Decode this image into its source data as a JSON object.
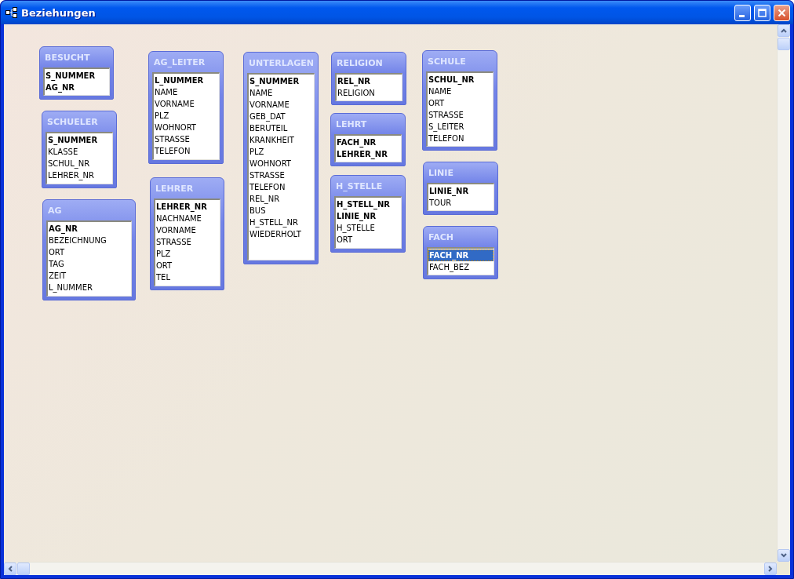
{
  "window": {
    "title": "Beziehungen"
  },
  "tables": [
    {
      "name": "BESUCHT",
      "fields": [
        {
          "name": "S_NUMMER",
          "key": true,
          "selected": false
        },
        {
          "name": "AG_NR",
          "key": true,
          "selected": false
        }
      ]
    },
    {
      "name": "SCHUELER",
      "fields": [
        {
          "name": "S_NUMMER",
          "key": true,
          "selected": false
        },
        {
          "name": "KLASSE",
          "key": false,
          "selected": false
        },
        {
          "name": "SCHUL_NR",
          "key": false,
          "selected": false
        },
        {
          "name": "LEHRER_NR",
          "key": false,
          "selected": false
        }
      ]
    },
    {
      "name": "AG",
      "fields": [
        {
          "name": "AG_NR",
          "key": true,
          "selected": false
        },
        {
          "name": "BEZEICHNUNG",
          "key": false,
          "selected": false
        },
        {
          "name": "ORT",
          "key": false,
          "selected": false
        },
        {
          "name": "TAG",
          "key": false,
          "selected": false
        },
        {
          "name": "ZEIT",
          "key": false,
          "selected": false
        },
        {
          "name": "L_NUMMER",
          "key": false,
          "selected": false
        }
      ]
    },
    {
      "name": "AG_LEITER",
      "fields": [
        {
          "name": "L_NUMMER",
          "key": true,
          "selected": false
        },
        {
          "name": "NAME",
          "key": false,
          "selected": false
        },
        {
          "name": "VORNAME",
          "key": false,
          "selected": false
        },
        {
          "name": "PLZ",
          "key": false,
          "selected": false
        },
        {
          "name": "WOHNORT",
          "key": false,
          "selected": false
        },
        {
          "name": "STRASSE",
          "key": false,
          "selected": false
        },
        {
          "name": "TELEFON",
          "key": false,
          "selected": false
        }
      ]
    },
    {
      "name": "LEHRER",
      "fields": [
        {
          "name": "LEHRER_NR",
          "key": true,
          "selected": false
        },
        {
          "name": "NACHNAME",
          "key": false,
          "selected": false
        },
        {
          "name": "VORNAME",
          "key": false,
          "selected": false
        },
        {
          "name": "STRASSE",
          "key": false,
          "selected": false
        },
        {
          "name": "PLZ",
          "key": false,
          "selected": false
        },
        {
          "name": "ORT",
          "key": false,
          "selected": false
        },
        {
          "name": "TEL",
          "key": false,
          "selected": false
        }
      ]
    },
    {
      "name": "UNTERLAGEN",
      "fields": [
        {
          "name": "S_NUMMER",
          "key": true,
          "selected": false
        },
        {
          "name": "NAME",
          "key": false,
          "selected": false
        },
        {
          "name": "VORNAME",
          "key": false,
          "selected": false
        },
        {
          "name": "GEB_DAT",
          "key": false,
          "selected": false
        },
        {
          "name": "BERUTEIL",
          "key": false,
          "selected": false
        },
        {
          "name": "KRANKHEIT",
          "key": false,
          "selected": false
        },
        {
          "name": "PLZ",
          "key": false,
          "selected": false
        },
        {
          "name": "WOHNORT",
          "key": false,
          "selected": false
        },
        {
          "name": "STRASSE",
          "key": false,
          "selected": false
        },
        {
          "name": "TELEFON",
          "key": false,
          "selected": false
        },
        {
          "name": "REL_NR",
          "key": false,
          "selected": false
        },
        {
          "name": "BUS",
          "key": false,
          "selected": false
        },
        {
          "name": "H_STELL_NR",
          "key": false,
          "selected": false
        },
        {
          "name": "WIEDERHOLT",
          "key": false,
          "selected": false
        }
      ]
    },
    {
      "name": "RELIGION",
      "fields": [
        {
          "name": "REL_NR",
          "key": true,
          "selected": false
        },
        {
          "name": "RELIGION",
          "key": false,
          "selected": false
        }
      ]
    },
    {
      "name": "LEHRT",
      "fields": [
        {
          "name": "FACH_NR",
          "key": true,
          "selected": false
        },
        {
          "name": "LEHRER_NR",
          "key": true,
          "selected": false
        }
      ]
    },
    {
      "name": "H_STELLE",
      "fields": [
        {
          "name": "H_STELL_NR",
          "key": true,
          "selected": false
        },
        {
          "name": "LINIE_NR",
          "key": true,
          "selected": false
        },
        {
          "name": "H_STELLE",
          "key": false,
          "selected": false
        },
        {
          "name": "ORT",
          "key": false,
          "selected": false
        }
      ]
    },
    {
      "name": "SCHULE",
      "fields": [
        {
          "name": "SCHUL_NR",
          "key": true,
          "selected": false
        },
        {
          "name": "NAME",
          "key": false,
          "selected": false
        },
        {
          "name": "ORT",
          "key": false,
          "selected": false
        },
        {
          "name": "STRASSE",
          "key": false,
          "selected": false
        },
        {
          "name": "S_LEITER",
          "key": false,
          "selected": false
        },
        {
          "name": "TELEFON",
          "key": false,
          "selected": false
        }
      ]
    },
    {
      "name": "LINIE",
      "fields": [
        {
          "name": "LINIE_NR",
          "key": true,
          "selected": false
        },
        {
          "name": "TOUR",
          "key": false,
          "selected": false
        }
      ]
    },
    {
      "name": "FACH",
      "fields": [
        {
          "name": "FACH_NR",
          "key": true,
          "selected": true
        },
        {
          "name": "FACH_BEZ",
          "key": false,
          "selected": false
        }
      ]
    }
  ]
}
